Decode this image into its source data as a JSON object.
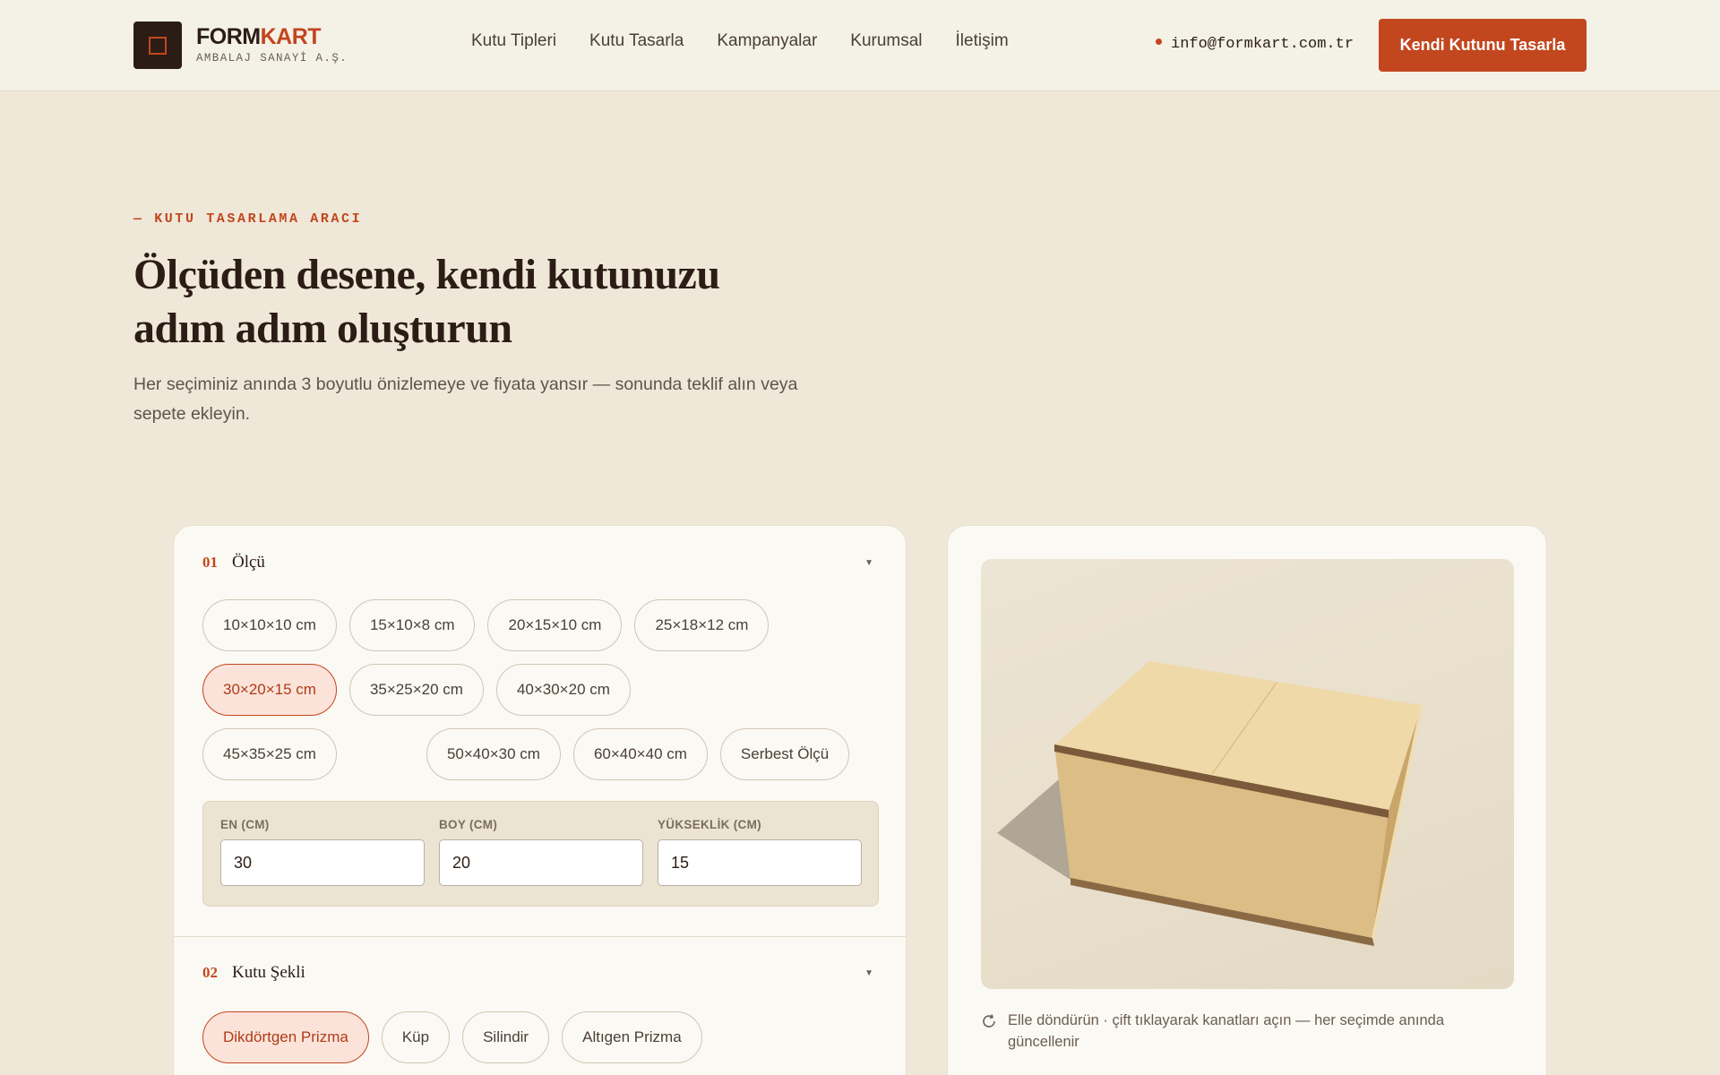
{
  "header": {
    "brand_primary": "FORM",
    "brand_accent": "KART",
    "brand_sub": "AMBALAJ SANAYİ A.Ş.",
    "nav": [
      "Kutu Tipleri",
      "Kutu Tasarla",
      "Kampanyalar",
      "Kurumsal",
      "İletişim"
    ],
    "email": "info@formkart.com.tr",
    "cta_label": "Kendi Kutunu Tasarla"
  },
  "hero": {
    "eyebrow": "— KUTU TASARLAMA ARACI",
    "title": "Ölçüden desene, kendi kutunuzu adım adım oluşturun",
    "subtitle": "Her seçiminiz anında 3 boyutlu önizlemeye ve fiyata yansır — sonunda teklif alın veya sepete ekleyin."
  },
  "configurator": {
    "size_section": {
      "number": "01",
      "title": "Ölçü",
      "options": [
        "10×10×10 cm",
        "15×10×8 cm",
        "20×15×10 cm",
        "25×18×12 cm",
        "30×20×15 cm",
        "35×25×20 cm",
        "40×30×20 cm",
        "45×35×25 cm",
        "50×40×30 cm",
        "60×40×40 cm",
        "Serbest Ölçü"
      ],
      "selected": "30×20×15 cm",
      "width_label": "EN (CM)",
      "width_value": "30",
      "length_label": "BOY (CM)",
      "length_value": "20",
      "height_label": "YÜKSEKLİK (CM)",
      "height_value": "15"
    },
    "shape_section": {
      "number": "02",
      "title": "Kutu Şekli",
      "options": [
        "Dikdörtgen Prizma",
        "Küp",
        "Silindir",
        "Altıgen Prizma"
      ],
      "selected": "Dikdörtgen Prizma"
    }
  },
  "preview": {
    "hint": "Elle döndürün · çift tıklayarak kanatları açın — her seçimde anında güncellenir"
  },
  "colors": {
    "accent": "#c2461e",
    "dark": "#2b1d15",
    "background": "#efe8d9",
    "box_front": "#dbbd85",
    "box_top": "#efd9a8"
  }
}
